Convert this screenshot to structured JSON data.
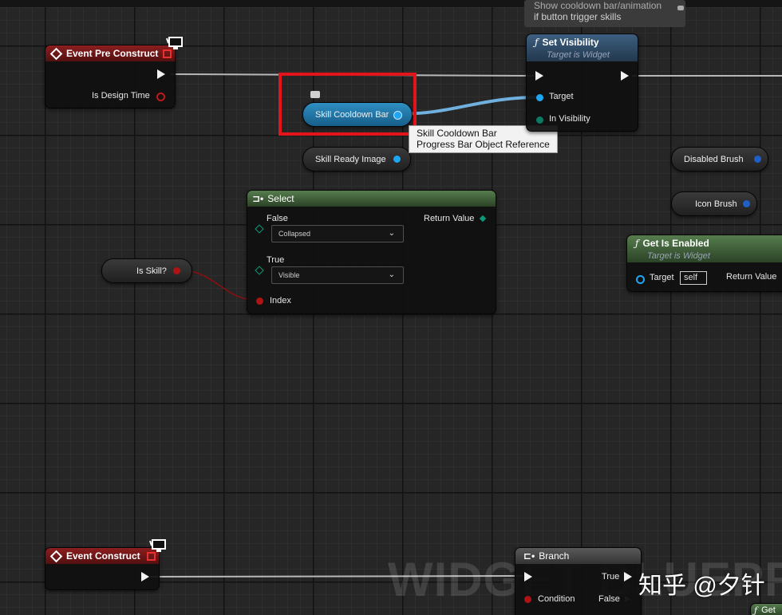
{
  "comment": {
    "line1": "Show cooldown bar/animation",
    "line2": "if button trigger skills"
  },
  "nodes": {
    "event_pre_construct": {
      "title": "Event Pre Construct",
      "pin_label": "Is Design Time"
    },
    "set_visibility": {
      "title": "Set Visibility",
      "subtitle": "Target is Widget",
      "target_label": "Target",
      "visibility_label": "In Visibility"
    },
    "select": {
      "title": "Select",
      "false_label": "False",
      "false_value": "Collapsed",
      "true_label": "True",
      "true_value": "Visible",
      "index_label": "Index",
      "return_label": "Return Value"
    },
    "get_is_enabled": {
      "title": "Get Is Enabled",
      "subtitle": "Target is Widget",
      "target_label": "Target",
      "target_value": "self",
      "return_label": "Return Value"
    },
    "event_construct": {
      "title": "Event Construct"
    },
    "branch": {
      "title": "Branch",
      "condition_label": "Condition",
      "true_label": "True",
      "false_label": "False"
    },
    "partial_node": {
      "title": "Get"
    }
  },
  "variables": {
    "skill_cooldown_bar": "Skill Cooldown Bar",
    "skill_ready_image": "Skill Ready Image",
    "disabled_brush": "Disabled Brush",
    "icon_brush": "Icon Brush",
    "is_skill": "Is Skill?"
  },
  "tooltip": {
    "line1": "Skill Cooldown Bar",
    "line2": "Progress Bar Object Reference"
  },
  "watermark": "WIDGET BLUEPRINT",
  "brand": "知乎 @夕针",
  "colors": {
    "event_header": "#8c1e1e",
    "function_header": "#3d5f80",
    "pure_header": "#567d4e",
    "object_pin": "#1ea6f2",
    "bool_pin": "#a11616",
    "enum_pin": "#0a7a63",
    "highlight": "#e3141b"
  },
  "icons": {
    "function": "function-icon",
    "event": "event-diamond-icon",
    "monitor": "monitor-icon",
    "comment": "comment-bubble-icon",
    "dropdown": "chevron-down-icon",
    "branch": "branch-icon",
    "select": "select-icon"
  }
}
